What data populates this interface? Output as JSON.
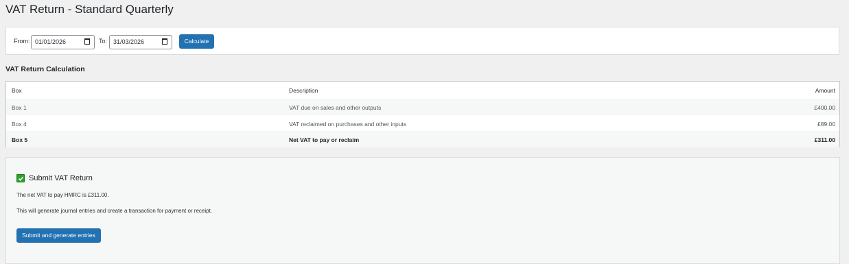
{
  "page": {
    "title": "VAT Return - Standard Quarterly"
  },
  "filter": {
    "from_label": "From:",
    "from_value": "01/01/2026",
    "to_label": "To:",
    "to_value": "31/03/2026",
    "calculate_label": "Calculate"
  },
  "calculation": {
    "heading": "VAT Return Calculation",
    "columns": [
      "Box",
      "Description",
      "Amount"
    ],
    "rows": [
      {
        "box": "Box 1",
        "description": "VAT due on sales and other outputs",
        "amount": "£400.00"
      },
      {
        "box": "Box 4",
        "description": "VAT reclaimed on purchases and other inputs",
        "amount": "£89.00"
      },
      {
        "box": "Box 5",
        "description": "Net VAT to pay or reclaim",
        "amount": "£311.00"
      }
    ]
  },
  "submit": {
    "icon": "check-mark-icon",
    "title": "Submit VAT Return",
    "net_text": "The net VAT to pay HMRC is £311.00.",
    "info_text": "This will generate journal entries and create a transaction for payment or receipt.",
    "button_label": "Submit and generate entries"
  },
  "colors": {
    "primary": "#2271b1",
    "success": "#2ea22e",
    "background": "#f0f0f1"
  }
}
